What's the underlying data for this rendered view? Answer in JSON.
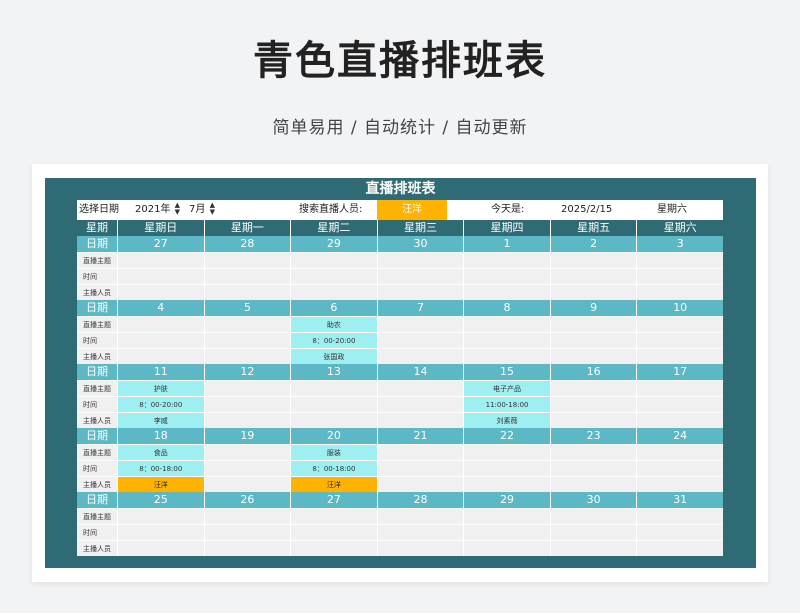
{
  "hero": {
    "title": "青色直播排班表",
    "subtitle": "简单易用 / 自动统计 / 自动更新"
  },
  "sheet": {
    "title": "直播排班表",
    "controls": {
      "select_date_label": "选择日期",
      "year": "2021年",
      "month": "7月",
      "search_label": "搜索直播人员:",
      "search_value": "汪洋",
      "today_label": "今天是:",
      "today_date": "2025/2/15",
      "today_weekday": "星期六"
    },
    "row_label_head": "星期",
    "weekdays": [
      "星期日",
      "星期一",
      "星期二",
      "星期三",
      "星期四",
      "星期五",
      "星期六"
    ],
    "date_label": "日期",
    "row_labels": [
      "直播主题",
      "时间",
      "主播人员"
    ],
    "weeks": [
      {
        "dates": [
          "27",
          "28",
          "29",
          "30",
          "1",
          "2",
          "3"
        ],
        "entries": []
      },
      {
        "dates": [
          "4",
          "5",
          "6",
          "7",
          "8",
          "9",
          "10"
        ],
        "entries": [
          {
            "col": 2,
            "theme": "助农",
            "time": "8：00-20:00",
            "host": "张国政",
            "highlight": false
          }
        ]
      },
      {
        "dates": [
          "11",
          "12",
          "13",
          "14",
          "15",
          "16",
          "17"
        ],
        "entries": [
          {
            "col": 0,
            "theme": "护肤",
            "time": "8：00-20:00",
            "host": "李威",
            "highlight": false
          },
          {
            "col": 4,
            "theme": "电子产品",
            "time": "11:00-18:00",
            "host": "刘素薇",
            "highlight": false
          }
        ]
      },
      {
        "dates": [
          "18",
          "19",
          "20",
          "21",
          "22",
          "23",
          "24"
        ],
        "entries": [
          {
            "col": 0,
            "theme": "食品",
            "time": "8：00-18:00",
            "host": "汪洋",
            "highlight": true
          },
          {
            "col": 2,
            "theme": "服装",
            "time": "8：00-18:00",
            "host": "汪洋",
            "highlight": true
          }
        ]
      },
      {
        "dates": [
          "25",
          "26",
          "27",
          "28",
          "29",
          "30",
          "31"
        ],
        "entries": []
      }
    ],
    "colors": {
      "frame": "#2e6b74",
      "date_bar": "#5bb8c4",
      "scheduled_cell": "#9eeff2",
      "search_highlight": "#ffb300",
      "empty_cell": "#f0f0f0"
    }
  }
}
